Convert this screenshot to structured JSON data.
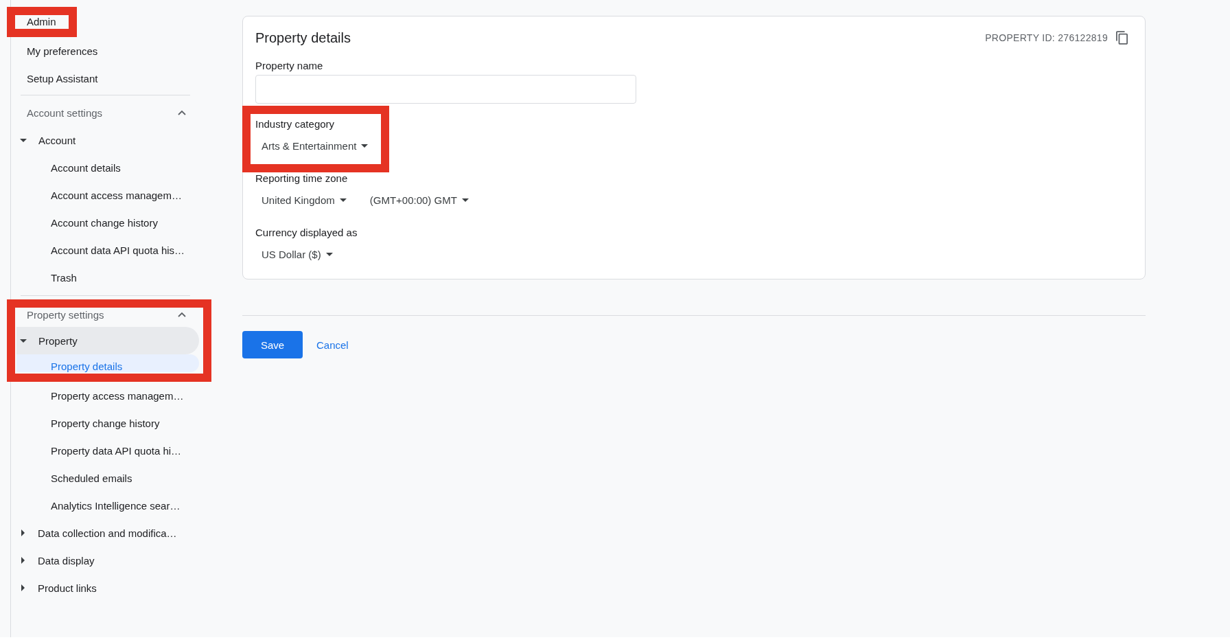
{
  "sidebar": {
    "top_items": [
      {
        "label": "Admin",
        "highlighted": true
      },
      {
        "label": "My preferences",
        "highlighted": false
      },
      {
        "label": "Setup Assistant",
        "highlighted": false
      }
    ],
    "sections": [
      {
        "title": "Account settings",
        "expanded": true,
        "highlighted": false,
        "groups": [
          {
            "label": "Account",
            "expanded": true,
            "selected": false,
            "highlighted": false,
            "children": [
              {
                "label": "Account details",
                "selected": false,
                "highlighted": false
              },
              {
                "label": "Account access managem…",
                "selected": false,
                "highlighted": false
              },
              {
                "label": "Account change history",
                "selected": false,
                "highlighted": false
              },
              {
                "label": "Account data API quota his…",
                "selected": false,
                "highlighted": false
              },
              {
                "label": "Trash",
                "selected": false,
                "highlighted": false
              }
            ]
          }
        ]
      },
      {
        "title": "Property settings",
        "expanded": true,
        "highlighted": true,
        "groups": [
          {
            "label": "Property",
            "expanded": true,
            "selected": true,
            "highlighted": true,
            "children": [
              {
                "label": "Property details",
                "selected": true,
                "highlighted": true
              },
              {
                "label": "Property access managem…",
                "selected": false,
                "highlighted": false
              },
              {
                "label": "Property change history",
                "selected": false,
                "highlighted": false
              },
              {
                "label": "Property data API quota hi…",
                "selected": false,
                "highlighted": false
              },
              {
                "label": "Scheduled emails",
                "selected": false,
                "highlighted": false
              },
              {
                "label": "Analytics Intelligence sear…",
                "selected": false,
                "highlighted": false
              }
            ]
          },
          {
            "label": "Data collection and modifica…",
            "expanded": false,
            "selected": false,
            "highlighted": false
          },
          {
            "label": "Data display",
            "expanded": false,
            "selected": false,
            "highlighted": false
          },
          {
            "label": "Product links",
            "expanded": false,
            "selected": false,
            "highlighted": false
          }
        ]
      }
    ]
  },
  "card": {
    "title": "Property details",
    "property_id": "PROPERTY ID: 276122819",
    "fields": [
      {
        "kind": "text",
        "label": "Property name",
        "highlighted": false
      },
      {
        "kind": "select",
        "label": "Industry category",
        "selects": [
          "Arts & Entertainment"
        ],
        "highlighted": true
      },
      {
        "kind": "select",
        "label": "Reporting time zone",
        "selects": [
          "United Kingdom",
          "(GMT+00:00) GMT"
        ],
        "highlighted": false
      },
      {
        "kind": "select",
        "label": "Currency displayed as",
        "selects": [
          "US Dollar ($)"
        ],
        "highlighted": false
      }
    ]
  },
  "actions": [
    {
      "kind": "primary",
      "label": "Save"
    },
    {
      "kind": "link",
      "label": "Cancel"
    }
  ]
}
